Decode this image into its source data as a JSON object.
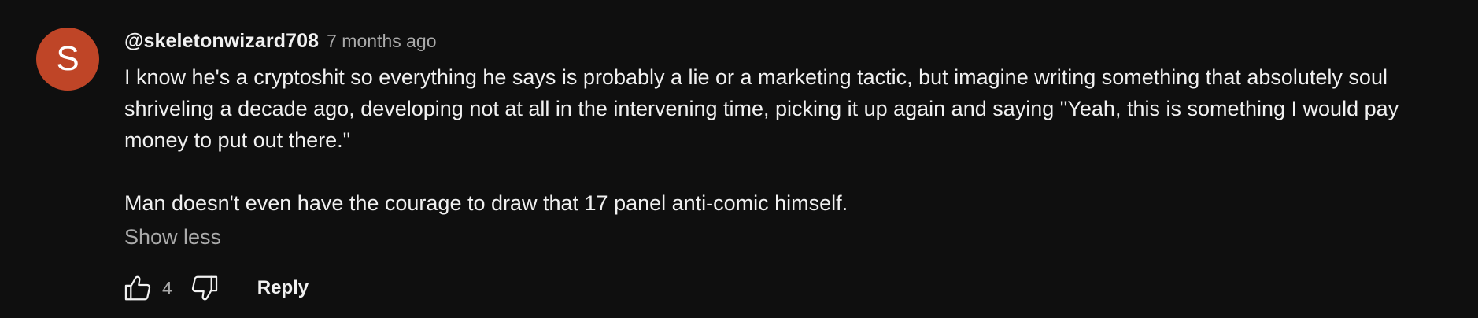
{
  "comment": {
    "avatar_letter": "S",
    "avatar_color": "#bf4527",
    "author": "@skeletonwizard708",
    "time": "7 months ago",
    "paragraph_1": "I know he's a cryptoshit so everything he says is probably a lie or a marketing tactic, but imagine writing something that absolutely soul shriveling a decade ago, developing not at all in the intervening time, picking it up again and saying \"Yeah, this is something I would pay money to put out there.\"",
    "paragraph_2": "Man doesn't even have the courage to draw that 17 panel anti-comic himself.",
    "show_less_label": "Show less",
    "like_count": "4",
    "reply_label": "Reply",
    "icons": {
      "like": "thumbs-up-icon",
      "dislike": "thumbs-down-icon"
    }
  }
}
